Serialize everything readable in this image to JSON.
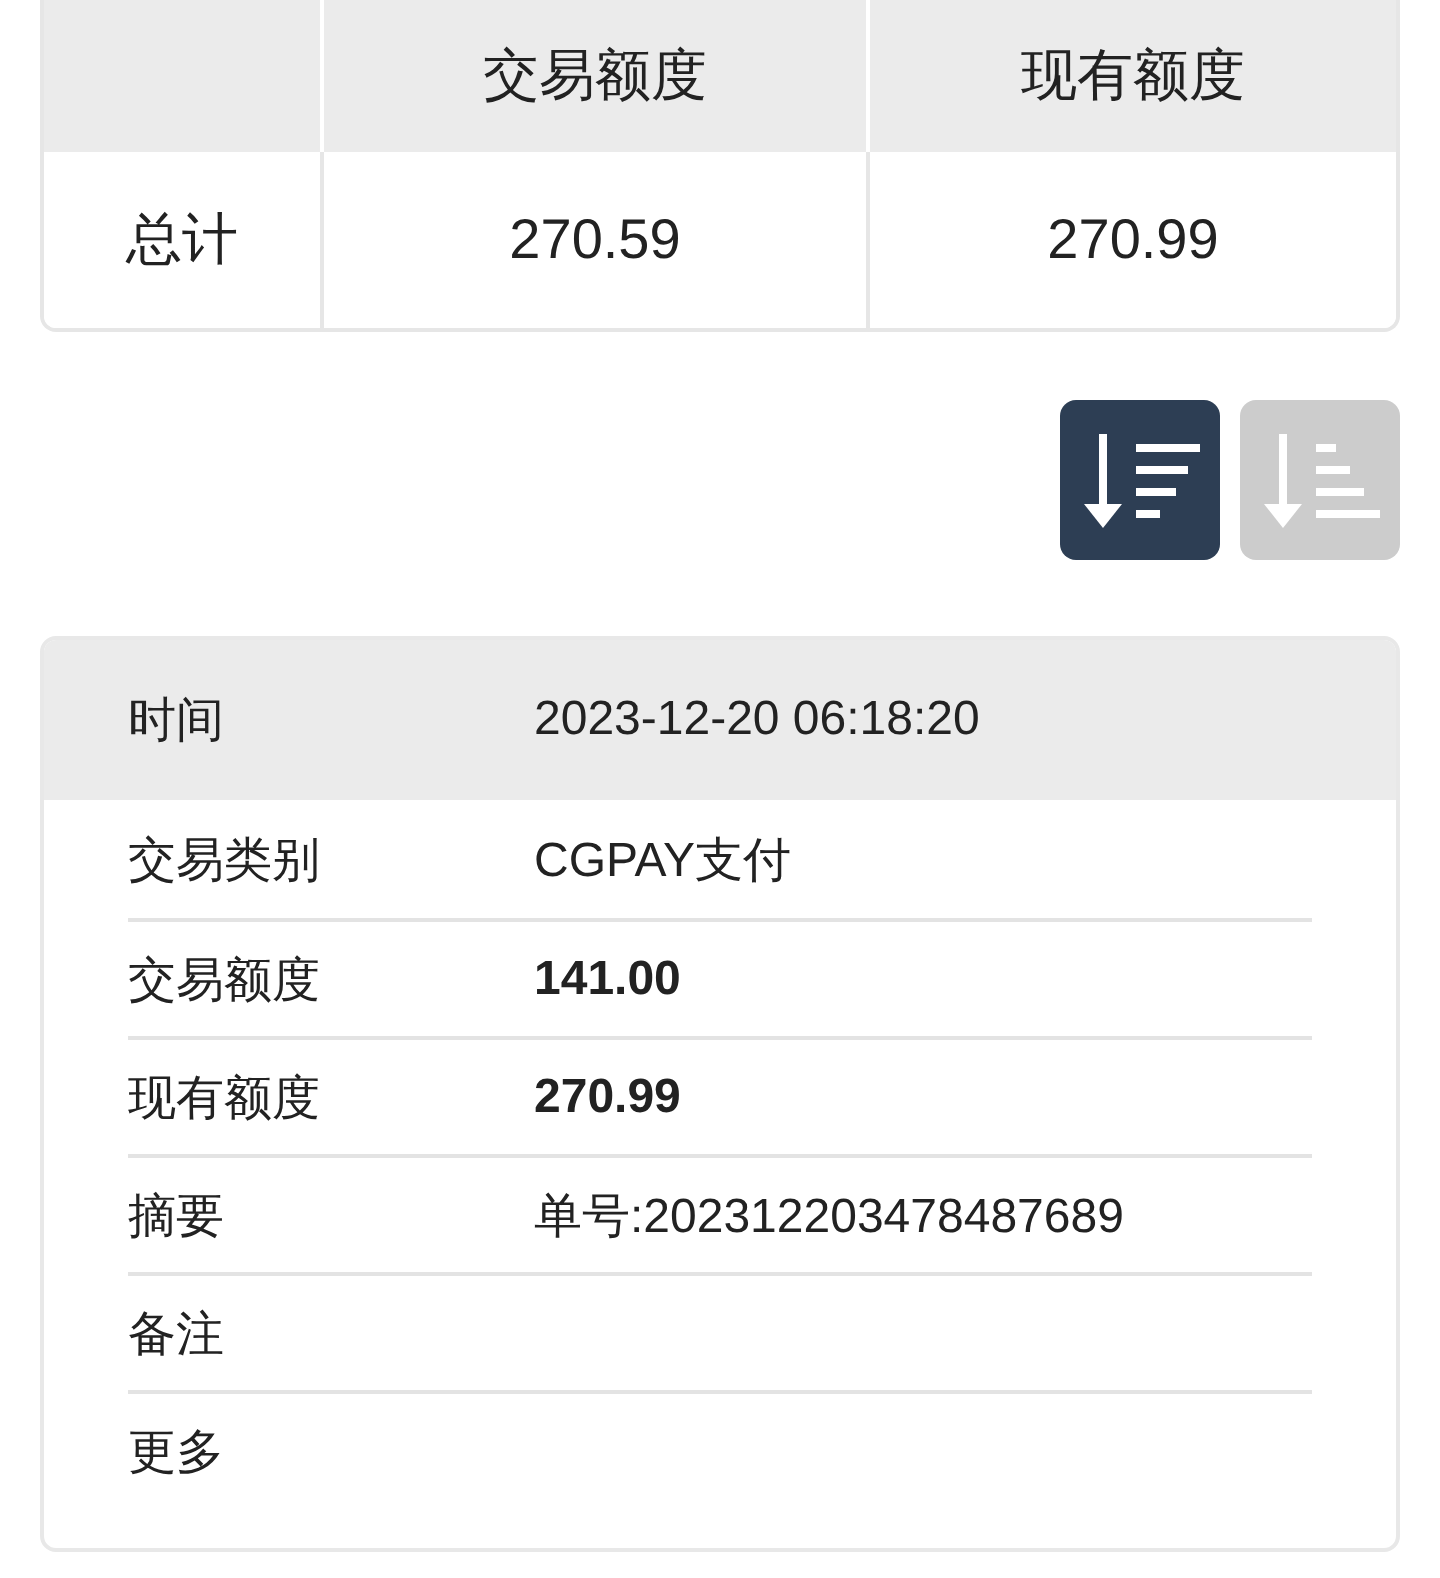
{
  "summary_table": {
    "columns": [
      "交易额度",
      "现有额度"
    ],
    "rows": [
      {
        "label": "总计",
        "cells": [
          "270.59",
          "270.99"
        ]
      }
    ]
  },
  "sort_buttons": [
    {
      "kind": "descending",
      "selected": true
    },
    {
      "kind": "ascending",
      "selected": false
    }
  ],
  "detail": {
    "header": {
      "label": "时间",
      "value": "2023-12-20 06:18:20"
    },
    "rows": [
      {
        "label": "交易类别",
        "value": "CGPAY支付",
        "bold": false
      },
      {
        "label": "交易额度",
        "value": "141.00",
        "bold": true
      },
      {
        "label": "现有额度",
        "value": "270.99",
        "bold": true
      },
      {
        "label": "摘要",
        "value": "单号:202312203478487689",
        "bold": false
      },
      {
        "label": "备注"
      },
      {
        "label": "更多"
      }
    ]
  }
}
